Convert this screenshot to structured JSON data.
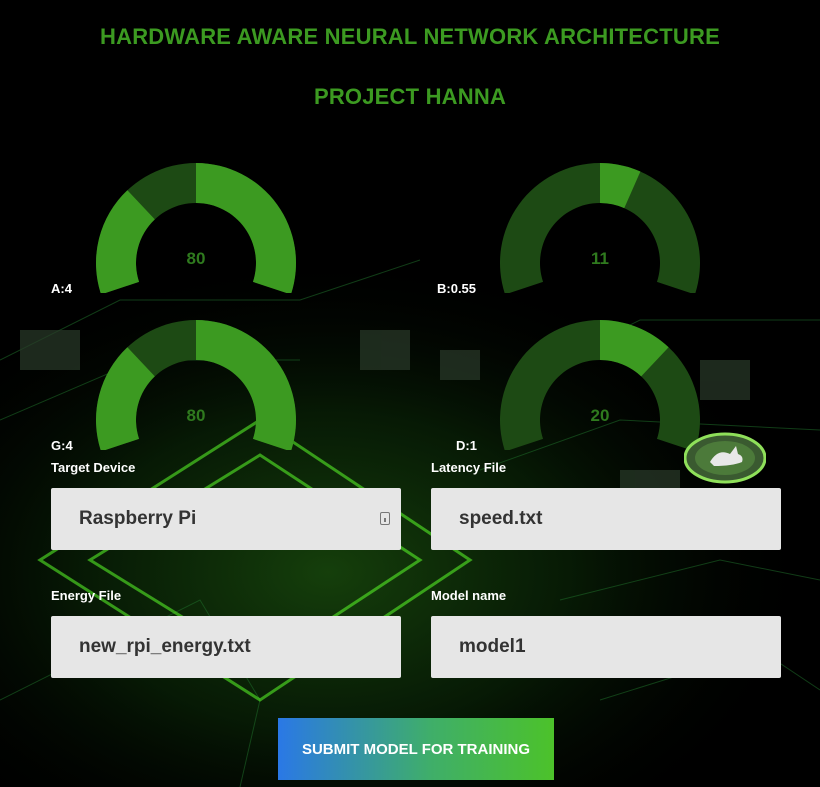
{
  "header": {
    "title": "HARDWARE AWARE NEURAL NETWORK ARCHITECTURE",
    "subtitle": "PROJECT HANNA"
  },
  "gauges": [
    {
      "id": "a",
      "label": "A:4",
      "value_text": "80",
      "value": 0.8
    },
    {
      "id": "b",
      "label": "B:0.55",
      "value_text": "11",
      "value": 0.11
    },
    {
      "id": "g",
      "label": "G:4",
      "value_text": "80",
      "value": 0.8
    },
    {
      "id": "d",
      "label": "D:1",
      "value_text": "20",
      "value": 0.2
    }
  ],
  "form": {
    "target_device": {
      "label": "Target Device",
      "value": "Raspberry Pi"
    },
    "latency_file": {
      "label": "Latency File",
      "value": "speed.txt"
    },
    "energy_file": {
      "label": "Energy File",
      "value": "new_rpi_energy.txt"
    },
    "model_name": {
      "label": "Model name",
      "value": "model1"
    },
    "submit_label": "SUBMIT MODEL FOR TRAINING"
  },
  "colors": {
    "accent": "#3c9a21",
    "gauge_fill": "#3c9a21",
    "gauge_track": "#1d4a14",
    "field_bg": "#e6e6e6"
  },
  "icons": [
    "contact-card-icon",
    "rabbit-logo-icon"
  ]
}
